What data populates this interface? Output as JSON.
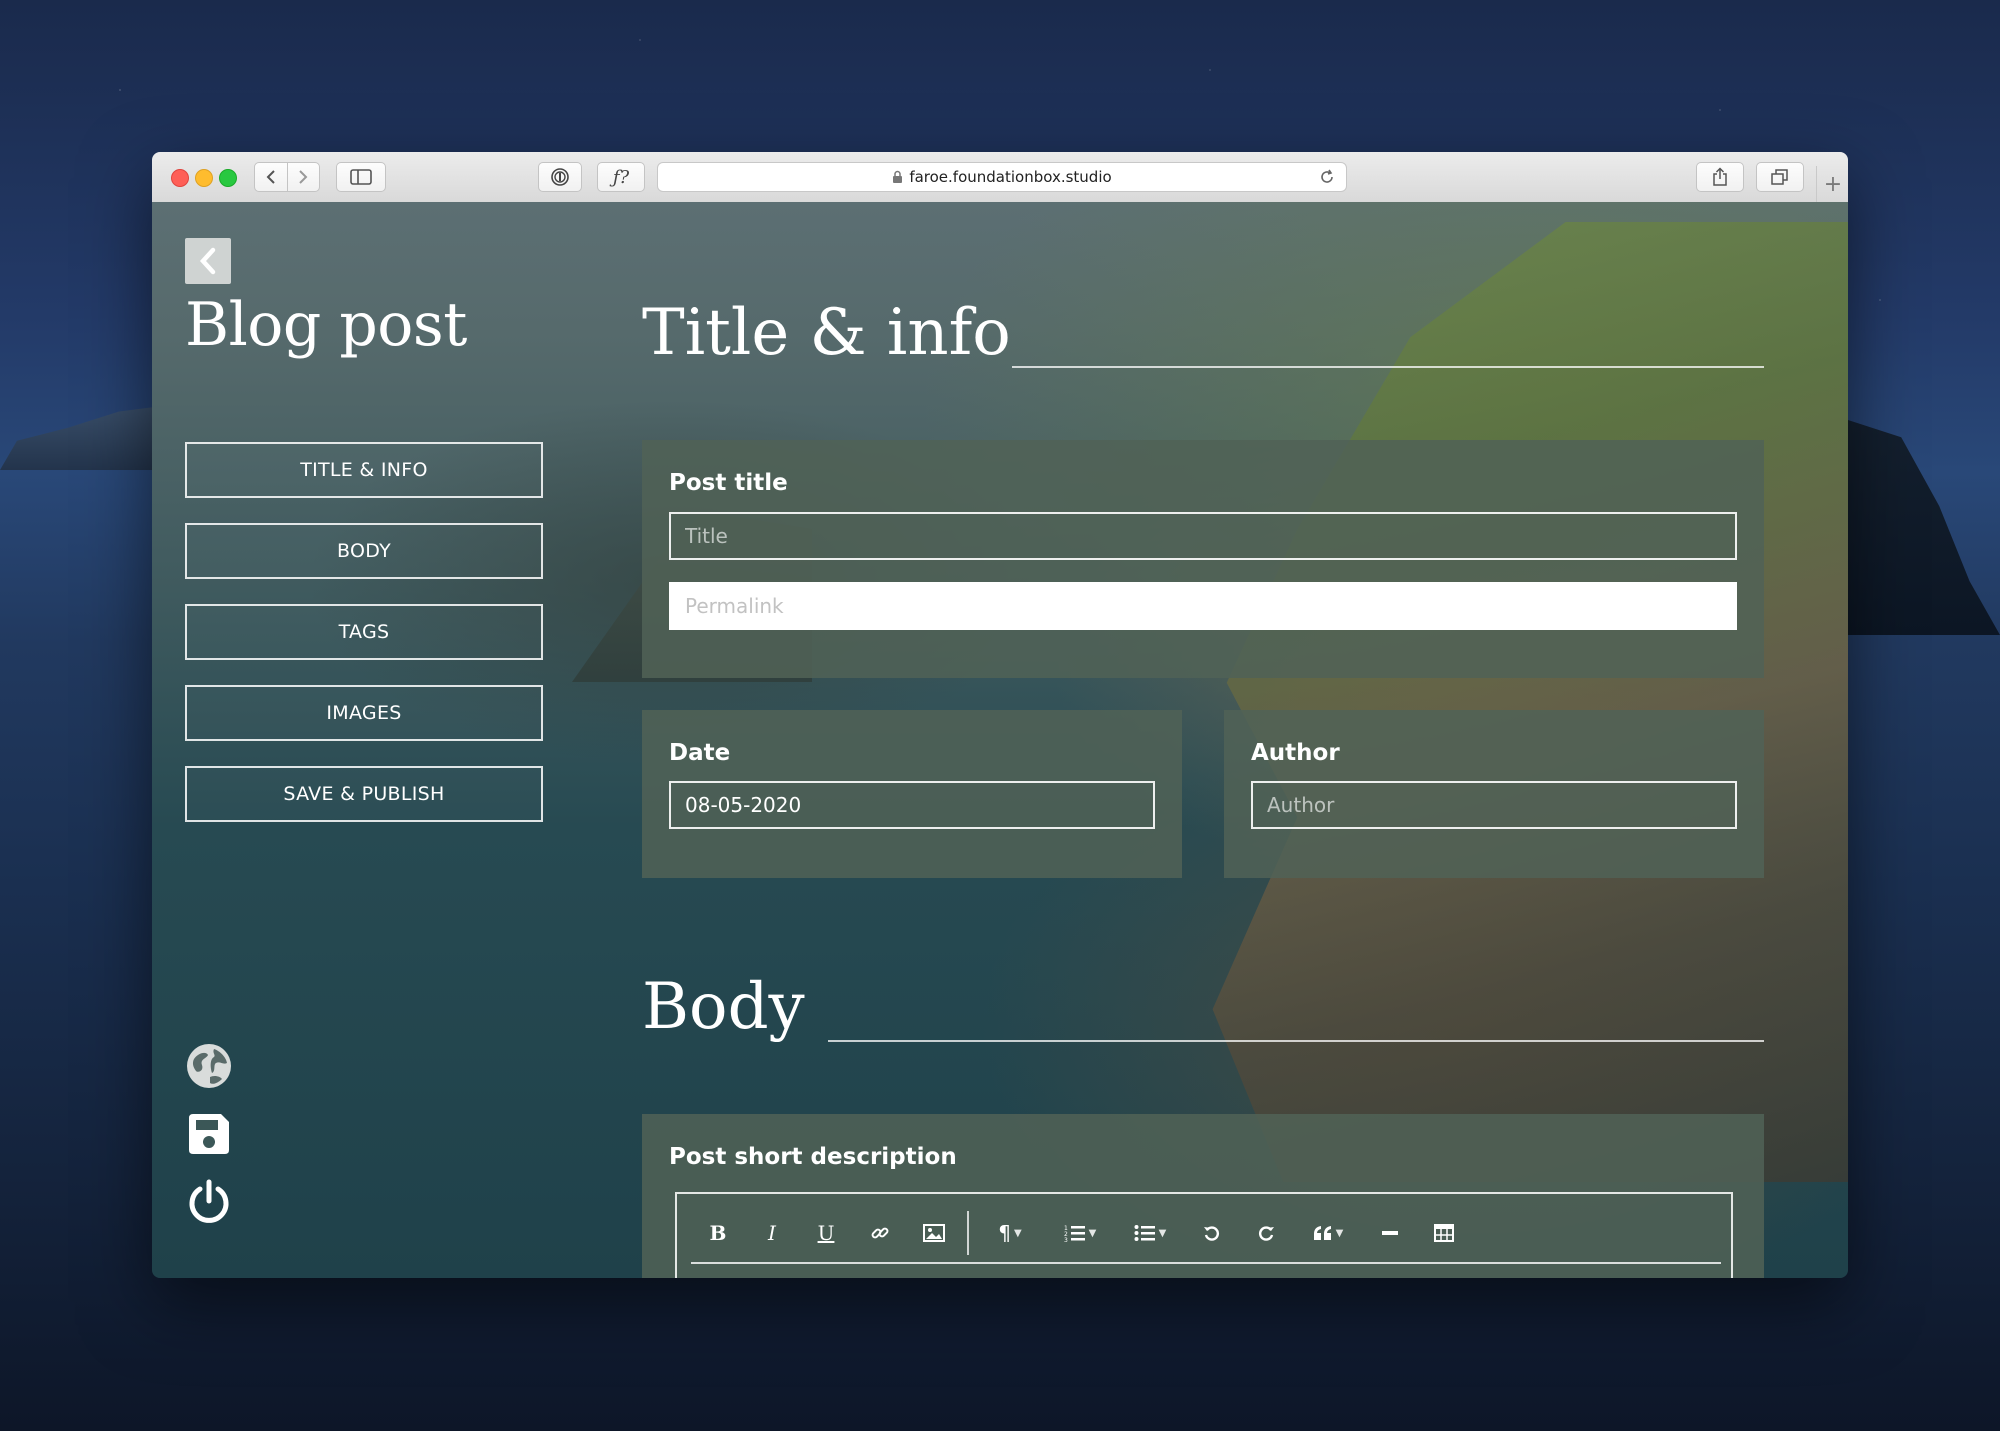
{
  "browser": {
    "url": "faroe.foundationbox.studio",
    "function_button_label": "ƒ?",
    "new_tab_label": "+"
  },
  "sidebar": {
    "heading": "Blog post",
    "nav": [
      {
        "label": "TITLE & INFO"
      },
      {
        "label": "BODY"
      },
      {
        "label": "TAGS"
      },
      {
        "label": "IMAGES"
      },
      {
        "label": "SAVE & PUBLISH"
      }
    ],
    "bottom_icons": [
      "globe-icon",
      "floppy-disk-icon",
      "power-icon"
    ]
  },
  "title_info": {
    "heading": "Title & info",
    "post_title": {
      "label": "Post title",
      "title_placeholder": "Title",
      "permalink_placeholder": "Permalink"
    },
    "date": {
      "label": "Date",
      "value": "08-05-2020"
    },
    "author": {
      "label": "Author",
      "placeholder": "Author"
    }
  },
  "body_section": {
    "heading": "Body",
    "short_description_label": "Post short description",
    "editor_tools": [
      {
        "name": "bold-button",
        "glyph": "B"
      },
      {
        "name": "italic-button",
        "glyph": "I"
      },
      {
        "name": "underline-button",
        "glyph": "U"
      },
      {
        "name": "link-button",
        "glyph": "link-icon"
      },
      {
        "name": "image-button",
        "glyph": "image-icon"
      },
      {
        "name": "paragraph-button",
        "glyph": "¶"
      },
      {
        "name": "ordered-list-button",
        "glyph": "ordered-list-icon"
      },
      {
        "name": "unordered-list-button",
        "glyph": "unordered-list-icon"
      },
      {
        "name": "undo-button",
        "glyph": "undo-icon"
      },
      {
        "name": "redo-button",
        "glyph": "redo-icon"
      },
      {
        "name": "quote-button",
        "glyph": "quote-icon"
      },
      {
        "name": "horizontal-rule-button",
        "glyph": "horizontal-rule-icon"
      },
      {
        "name": "table-button",
        "glyph": "table-icon"
      }
    ]
  },
  "colors": {
    "panel": "#506256",
    "text": "#ffffff",
    "close": "#fe5f57",
    "minimize": "#febc2e",
    "zoom": "#28c840"
  }
}
